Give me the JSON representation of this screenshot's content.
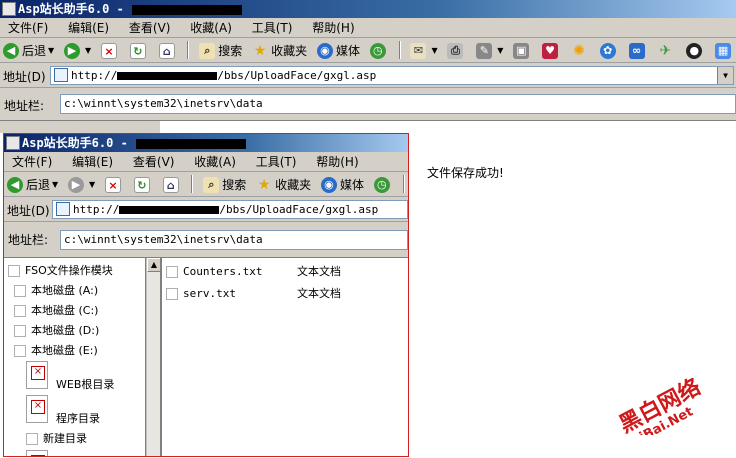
{
  "back_window": {
    "title_prefix": "Asp站长助手6.0 -",
    "menu": [
      "文件(F)",
      "编辑(E)",
      "查看(V)",
      "收藏(A)",
      "工具(T)",
      "帮助(H)"
    ],
    "toolbar": {
      "back": "后退",
      "search": "搜索",
      "favorites": "收藏夹",
      "media": "媒体"
    },
    "address_label": "地址(D)",
    "address_prefix": "http://",
    "address_suffix": "/bbs/UploadFace/gxgl.asp",
    "path_label": "地址栏:",
    "path_value": "c:\\winnt\\system32\\inetsrv\\data",
    "message": "文件保存成功!"
  },
  "front_window": {
    "title_prefix": "Asp站长助手6.0 -",
    "menu": [
      "文件(F)",
      "编辑(E)",
      "查看(V)",
      "收藏(A)",
      "工具(T)",
      "帮助(H)"
    ],
    "toolbar": {
      "back": "后退",
      "search": "搜索",
      "favorites": "收藏夹",
      "media": "媒体"
    },
    "address_label": "地址(D)",
    "address_prefix": "http://",
    "address_suffix": "/bbs/UploadFace/gxgl.asp",
    "path_label": "地址栏:",
    "path_value": "c:\\winnt\\system32\\inetsrv\\data",
    "tree": {
      "root": "FSO文件操作模块",
      "drives": [
        "本地磁盘 (A:)",
        "本地磁盘 (C:)",
        "本地磁盘 (D:)",
        "本地磁盘 (E:)"
      ],
      "web_root": "WEB根目录",
      "program_dir": "程序目录",
      "new_dir": "新建目录"
    },
    "files": [
      {
        "name": "Counters.txt",
        "type": "文本文档"
      },
      {
        "name": "serv.txt",
        "type": "文本文档"
      }
    ]
  },
  "watermark": {
    "line1": "黑白网络",
    "line2": "HeiBai.Net"
  },
  "colors": {
    "title_start": "#0a246a",
    "title_end": "#a6caf0",
    "chrome": "#d4d0c8",
    "frame_border": "#d02020",
    "watermark": "#d01818"
  }
}
